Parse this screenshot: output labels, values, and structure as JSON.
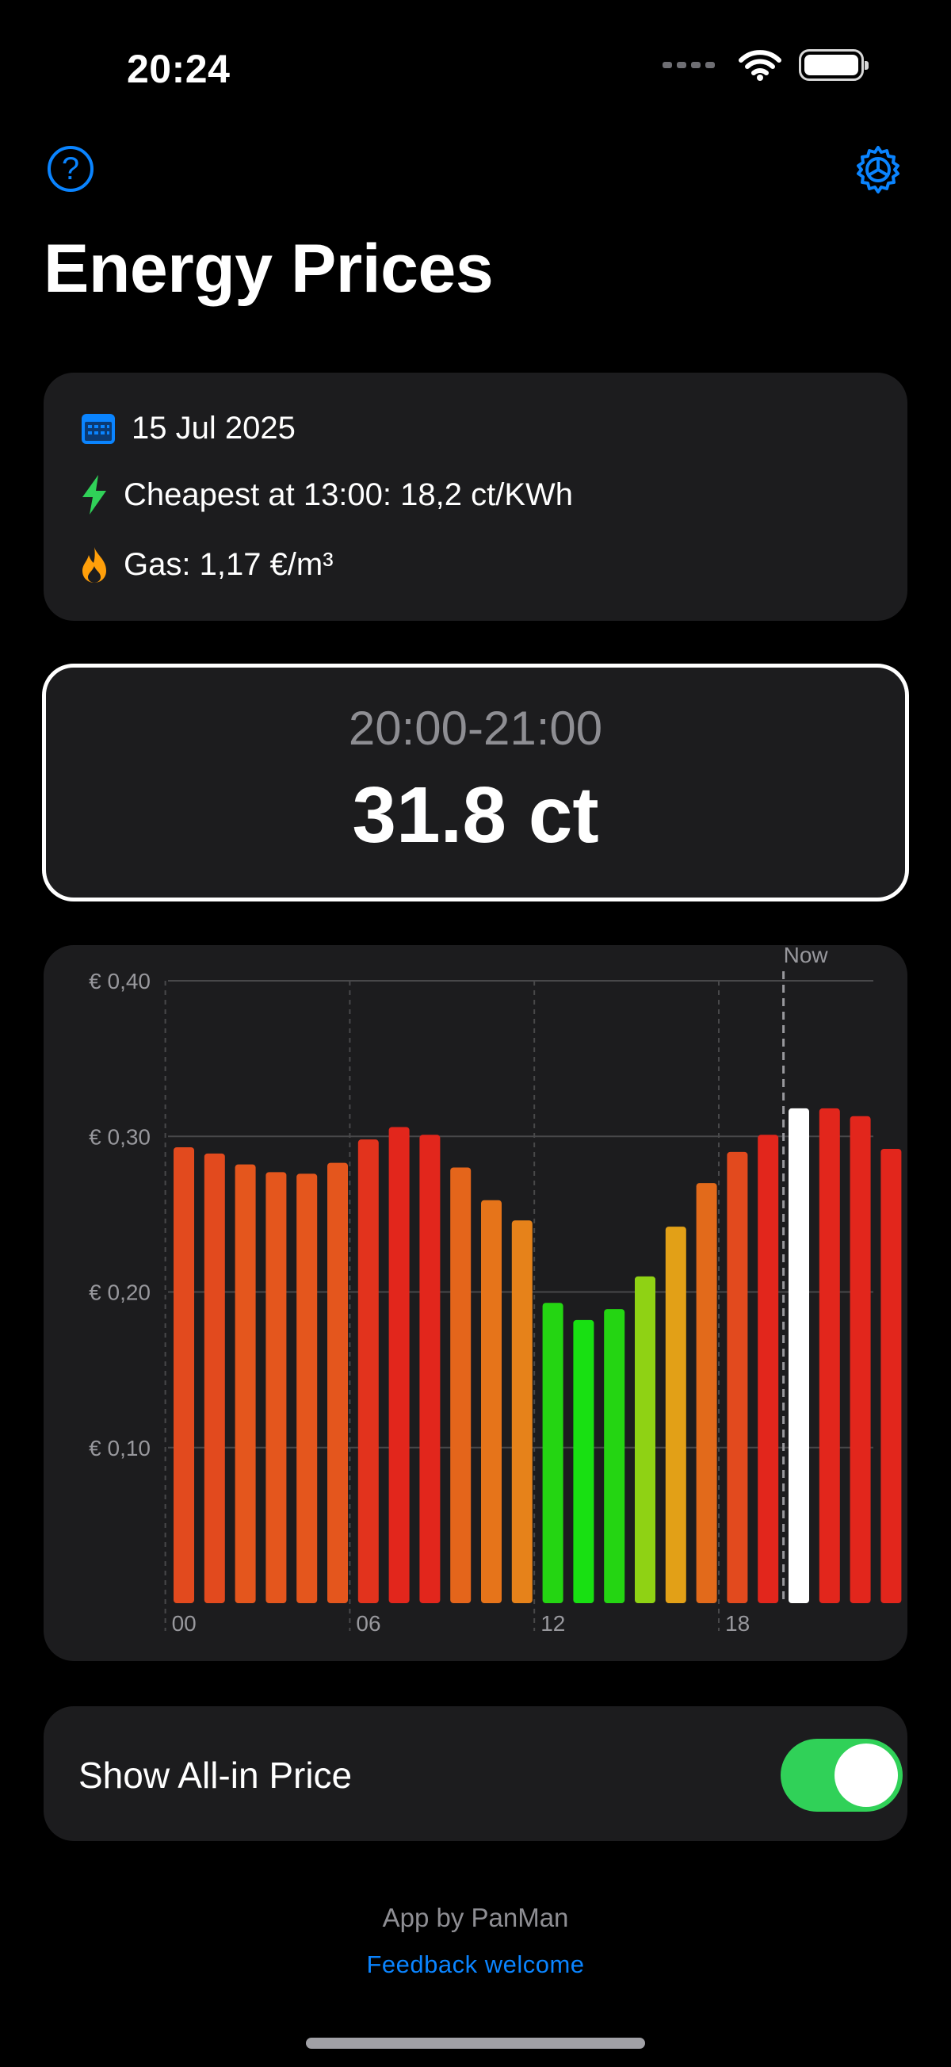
{
  "status_bar": {
    "time": "20:24"
  },
  "header": {
    "title": "Energy Prices",
    "help_glyph": "?"
  },
  "info": {
    "date": "15 Jul 2025",
    "cheapest": "Cheapest at 13:00: 18,2 ct/KWh",
    "gas": "Gas: 1,17 €/m³"
  },
  "current_price": {
    "time_range": "20:00-21:00",
    "value": "31.8 ct"
  },
  "chart_data": {
    "type": "bar",
    "x": [
      0,
      1,
      2,
      3,
      4,
      5,
      6,
      7,
      8,
      9,
      10,
      11,
      12,
      13,
      14,
      15,
      16,
      17,
      18,
      19,
      20,
      21,
      22,
      23
    ],
    "values": [
      0.293,
      0.289,
      0.282,
      0.277,
      0.276,
      0.283,
      0.298,
      0.306,
      0.301,
      0.28,
      0.259,
      0.246,
      0.193,
      0.182,
      0.189,
      0.21,
      0.242,
      0.27,
      0.29,
      0.301,
      0.318,
      0.318,
      0.313,
      0.292
    ],
    "colors": [
      "#e24a1e",
      "#e24a1e",
      "#e4561d",
      "#e4561d",
      "#e4561d",
      "#e4561d",
      "#e2331d",
      "#e2261c",
      "#e2261c",
      "#e4651b",
      "#e6741a",
      "#e6821a",
      "#24d512",
      "#18e012",
      "#24d512",
      "#8fd214",
      "#e2a017",
      "#e26a1b",
      "#e24a1e",
      "#e2261c",
      "#ffffff",
      "#e2261c",
      "#e2261c",
      "#e2261c"
    ],
    "y_ticks": [
      {
        "value": 0.4,
        "label": "€ 0,40"
      },
      {
        "value": 0.3,
        "label": "€ 0,30"
      },
      {
        "value": 0.2,
        "label": "€ 0,20"
      },
      {
        "value": 0.1,
        "label": "€ 0,10"
      }
    ],
    "x_ticks": [
      {
        "value": 0,
        "label": "00"
      },
      {
        "value": 6,
        "label": "06"
      },
      {
        "value": 12,
        "label": "12"
      },
      {
        "value": 18,
        "label": "18"
      }
    ],
    "ylim": [
      0,
      0.4
    ],
    "now_hour": 20,
    "now_label": "Now",
    "grid": true
  },
  "settings": {
    "all_in_label": "Show All-in Price",
    "all_in_enabled": true
  },
  "footer": {
    "credit": "App by PanMan",
    "feedback": "Feedback welcome"
  },
  "colors": {
    "accent": "#0a84ff",
    "card": "#1c1c1e",
    "toggle_on": "#30d158",
    "lightning": "#30d158",
    "flame": "#ff9f0a"
  }
}
